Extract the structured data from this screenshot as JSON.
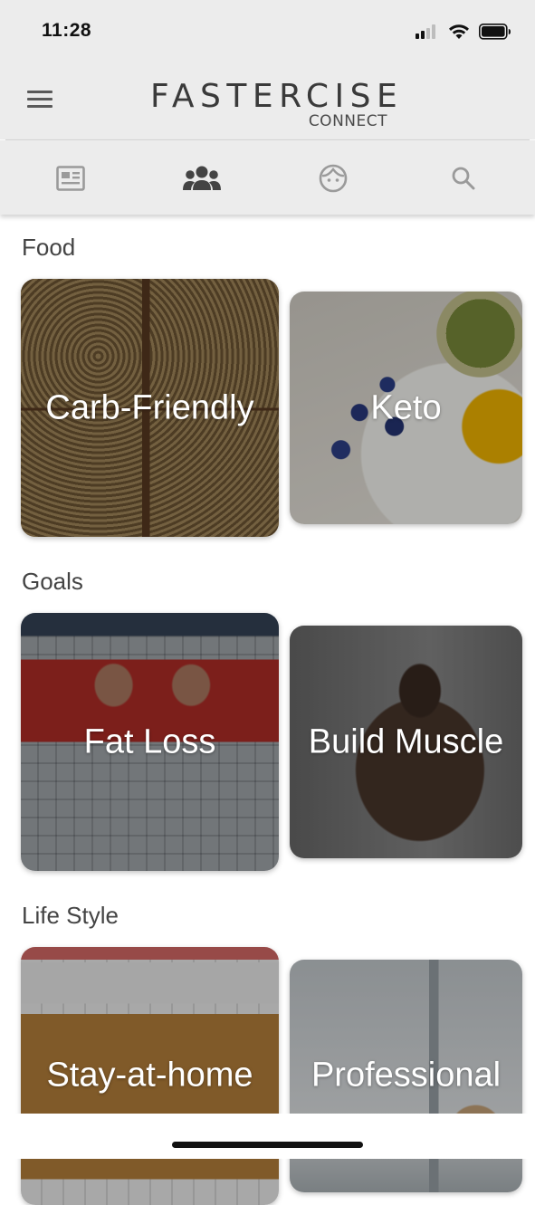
{
  "status_bar": {
    "time": "11:28",
    "icons": [
      "signal-icon",
      "wifi-icon",
      "battery-icon"
    ]
  },
  "header": {
    "menu_icon": "hamburger-menu-icon",
    "logo_main": "FASTERCISE",
    "logo_sub": "CONNECT"
  },
  "tabs": [
    {
      "name": "news",
      "icon": "newspaper-icon",
      "active": false
    },
    {
      "name": "community",
      "icon": "group-icon",
      "active": true
    },
    {
      "name": "profile",
      "icon": "face-icon",
      "active": false
    },
    {
      "name": "search",
      "icon": "search-icon",
      "active": false
    }
  ],
  "sections": [
    {
      "title": "Food",
      "cards": [
        {
          "label": "Carb-Friendly"
        },
        {
          "label": "Keto"
        }
      ]
    },
    {
      "title": "Goals",
      "cards": [
        {
          "label": "Fat Loss"
        },
        {
          "label": "Build Muscle"
        }
      ]
    },
    {
      "title": "Life Style",
      "cards": [
        {
          "label": "Stay-at-home"
        },
        {
          "label": "Professional"
        }
      ]
    }
  ],
  "colors": {
    "header_bg": "#ececec",
    "active_tab": "#444444",
    "inactive_tab": "#9a9a9a",
    "text": "#444444"
  }
}
